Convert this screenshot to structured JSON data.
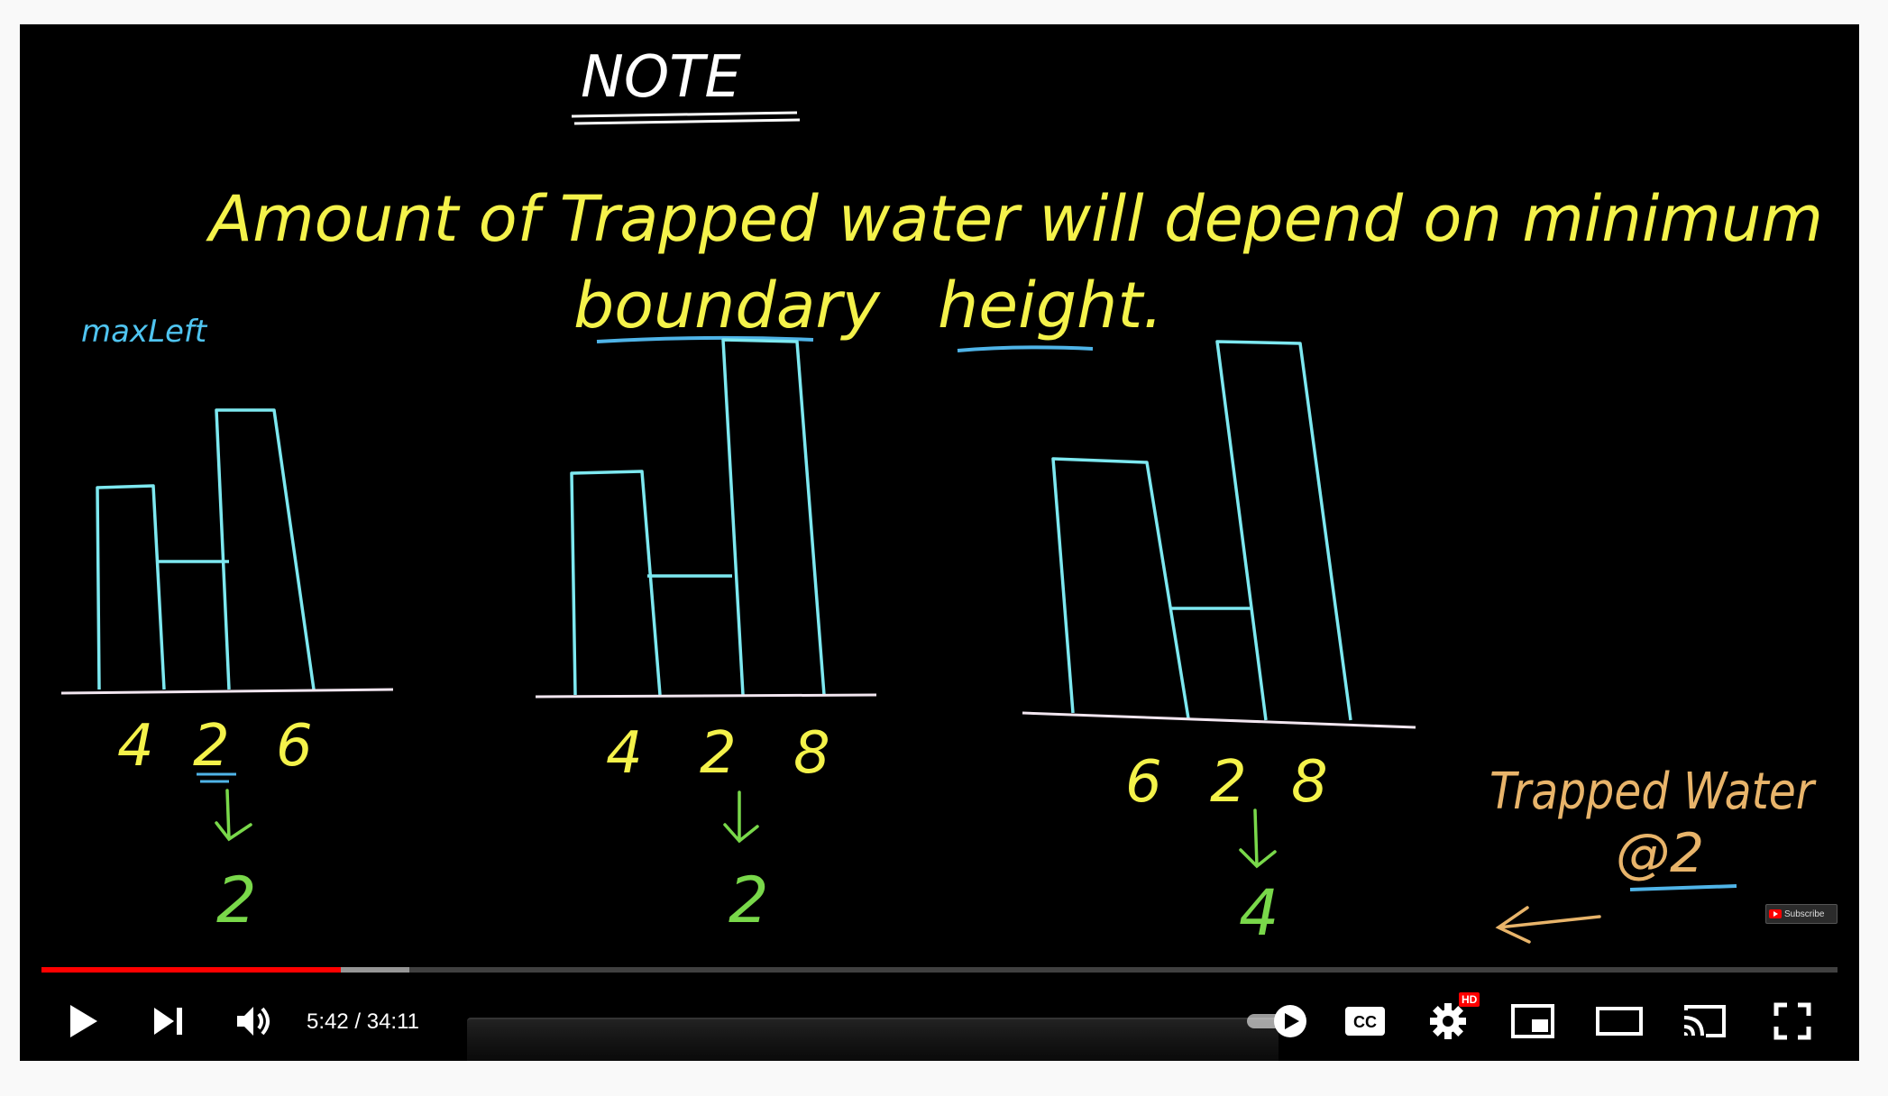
{
  "board": {
    "note_heading": "NOTE",
    "sentence_line1": "Amount of Trapped water will depend on minimum",
    "sentence_line2_word1": "boundary",
    "sentence_line2_word2": "height.",
    "margin_label": "maxLeft",
    "examples": [
      {
        "left": "4",
        "middle": "2",
        "right": "6",
        "result": "2"
      },
      {
        "left": "4",
        "middle": "2",
        "right": "8",
        "result": "2"
      },
      {
        "left": "6",
        "middle": "2",
        "right": "8",
        "result": "4"
      }
    ],
    "side_note_line1": "Trapped Water",
    "side_note_line2": "@2",
    "colors": {
      "heading": "#ffffff",
      "sentence": "#f4f24a",
      "bars": "#7de8f0",
      "baseline": "#f2e6f0",
      "result": "#79d84a",
      "side_note": "#e8b46a",
      "underline": "#4fb4e8"
    }
  },
  "player": {
    "current_time": "5:42",
    "duration": "34:11",
    "time_display": "5:42 / 34:11",
    "progress_fraction": 0.1669,
    "buffered_fraction": 0.205,
    "hd_badge": "HD",
    "watermark_label": "Subscribe",
    "controls": {
      "play": "play-icon",
      "next": "next-icon",
      "volume": "volume-icon",
      "autoplay": "autoplay-toggle-icon",
      "captions": "cc-icon",
      "settings": "gear-icon",
      "miniplayer": "miniplayer-icon",
      "theater": "theater-icon",
      "cast": "cast-icon",
      "fullscreen": "fullscreen-icon"
    },
    "colors": {
      "progress": "#ff0000",
      "hd": "#ff0000"
    }
  }
}
